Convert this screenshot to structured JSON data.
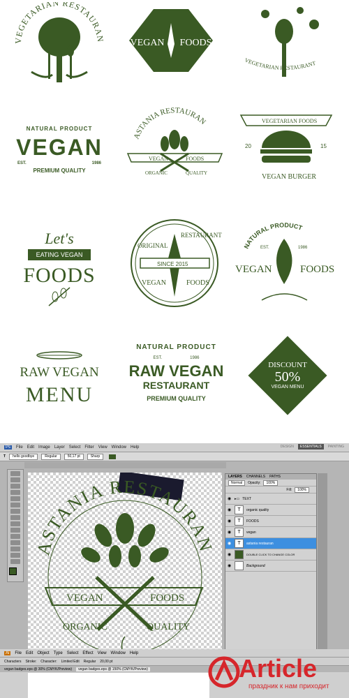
{
  "colors": {
    "brand_green": "#3a5a24",
    "watermark_red": "#d6262b",
    "ps_selection": "#3d8fe0"
  },
  "logos": {
    "l1": {
      "arc": "VEGETARIAN RESTAURANT"
    },
    "l2": {
      "line1": "VEGAN",
      "line2": "FOODS"
    },
    "l3": {
      "arc": "VEGETARIAN   RESTAURANT"
    },
    "l4": {
      "top": "NATURAL  PRODUCT",
      "main": "VEGAN",
      "est": "EST.",
      "year": "1986",
      "bottom": "PREMIUM QUALITY"
    },
    "l5": {
      "arc": "ASTANIA RESTAURAN",
      "ribbon_left": "VEGAN",
      "ribbon_right": "FOODS",
      "left": "ORGANIC",
      "right": "QUALITY"
    },
    "l6": {
      "ribbon": "VEGETARIAN FOODS",
      "left_num": "20",
      "right_num": "15",
      "bottom": "VEGAN BURGER"
    },
    "l7": {
      "line1": "Let's",
      "ribbon": "EATING VEGAN",
      "main": "FOODS"
    },
    "l8": {
      "arc_top": "ORIGINAL",
      "arc_top2": "RESTAURANT",
      "ribbon": "SINCE  2015",
      "left": "VEGAN",
      "right": "FOODS"
    },
    "l9": {
      "arc": "NATURAL PRODUCT",
      "est": "EST.",
      "year": "1986",
      "left": "VEGAN",
      "right": "FOODS"
    },
    "l10": {
      "line1": "RAW VEGAN",
      "line2": "MENU"
    },
    "l11": {
      "arc": "NATURAL PRODUCT",
      "est": "EST.",
      "year": "1986",
      "main": "RAW VEGAN",
      "sub": "RESTAURANT",
      "bottom": "PREMIUM QUALITY"
    },
    "l12": {
      "line1": "DISCOUNT",
      "line2": "50%",
      "line3": "VEGAN MENU"
    }
  },
  "photoshop": {
    "menu": [
      "Ps",
      "File",
      "Edit",
      "Image",
      "Layer",
      "Select",
      "Filter",
      "View",
      "Window",
      "Help"
    ],
    "workspaces": [
      "DESIGN",
      "ESSENTIALS",
      "PAINTING"
    ],
    "active_workspace": "ESSENTIALS",
    "options": {
      "font": "hello goodbye",
      "style": "Regular",
      "size": "50,17 pt",
      "aa": "Sharp"
    },
    "canvas_art": {
      "arc": "ASTANIA RESTAURAN",
      "ribbon_left": "VEGAN",
      "ribbon_right": "FOODS",
      "bottom_left": "ORGANIC",
      "bottom_right": "QUALITY"
    },
    "layers_panel": {
      "tabs": [
        "LAYERS",
        "CHANNELS",
        "PATHS"
      ],
      "blend": "Normal",
      "opacity_label": "Opacity:",
      "opacity": "100%",
      "fill_label": "Fill:",
      "fill": "100%",
      "layers": [
        {
          "name": "TEXT",
          "kind": "group",
          "selected": false
        },
        {
          "name": "organic    quality",
          "kind": "text",
          "selected": false
        },
        {
          "name": "FOODS",
          "kind": "text",
          "selected": false
        },
        {
          "name": "vegan",
          "kind": "text",
          "selected": false
        },
        {
          "name": "astania restauran",
          "kind": "text",
          "selected": true
        },
        {
          "name": "DOUBLE CLICK TO CHANGE COLOR",
          "kind": "fill",
          "selected": false
        },
        {
          "name": "Background",
          "kind": "bg",
          "selected": false
        }
      ]
    },
    "second_menu": [
      "Ai",
      "File",
      "Edit",
      "Object",
      "Type",
      "Select",
      "Effect",
      "View",
      "Window",
      "Help"
    ],
    "second_options": [
      "Characters",
      "Stroke:",
      "Character:",
      "Limited Edit",
      "Regular",
      "20,00 pt"
    ],
    "second_tabs": [
      "vegan badges.eps @ 30% (CMYK/Preview)",
      "vegan badges.eps @ 150% (CMYK/Preview)"
    ]
  },
  "watermark": {
    "brand": "Article",
    "tagline": "праздник к нам приходит"
  }
}
